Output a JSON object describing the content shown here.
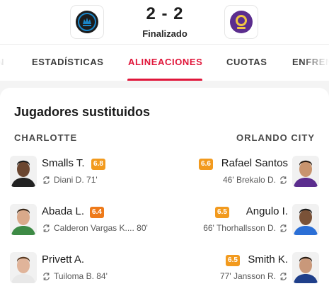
{
  "match": {
    "home_logo_icon": "charlotte-fc-crest-icon",
    "away_logo_icon": "orlando-city-crest-icon",
    "score": "2 - 2",
    "status": "Finalizado"
  },
  "tabs": [
    {
      "label": "N"
    },
    {
      "label": "ESTADÍSTICAS"
    },
    {
      "label": "ALINEACIONES",
      "active": true
    },
    {
      "label": "CUOTAS"
    },
    {
      "label": "ENFREN"
    }
  ],
  "section": {
    "title": "Jugadores sustituidos",
    "home_team": "CHARLOTTE",
    "away_team": "ORLANDO CITY"
  },
  "colors": {
    "accent": "#e0163a",
    "rating_high": "#f29a1e",
    "rating_mid": "#ee7a1a",
    "charlotte_blue": "#1a85c8",
    "orlando_purple": "#5b2d8e"
  },
  "home_subs": [
    {
      "name": "Smalls T.",
      "rating": "6.8",
      "replaced": "Diani D. 71'"
    },
    {
      "name": "Abada L.",
      "rating": "6.4",
      "replaced": "Calderon Vargas K.... 80'"
    },
    {
      "name": "Privett A.",
      "rating": "",
      "replaced": "Tuiloma B. 84'"
    }
  ],
  "away_subs": [
    {
      "name": "Rafael Santos",
      "rating": "6.6",
      "replaced": "46' Brekalo D."
    },
    {
      "name": "Angulo I.",
      "rating": "6.5",
      "replaced": "66' Thorhallsson D."
    },
    {
      "name": "Smith K.",
      "rating": "6.5",
      "replaced": "77' Jansson R."
    }
  ]
}
